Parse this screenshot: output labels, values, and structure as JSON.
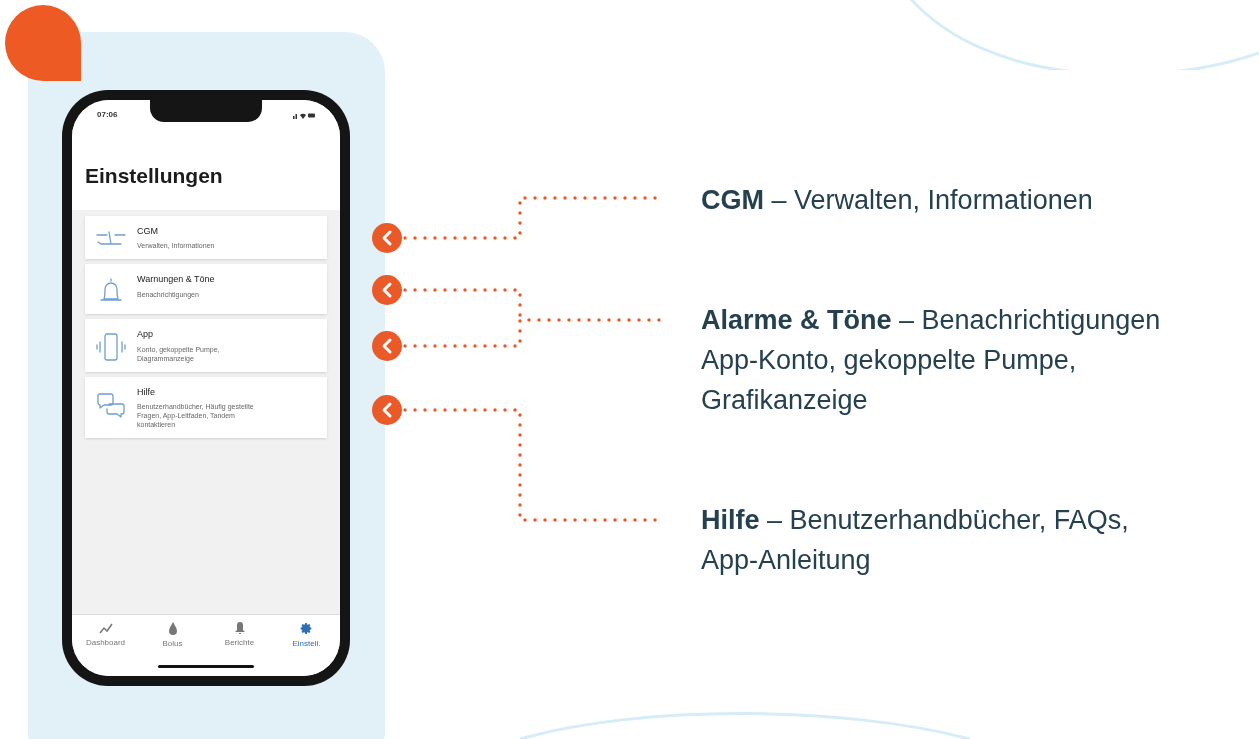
{
  "phone": {
    "status_time": "07:06",
    "title": "Einstellungen",
    "items": [
      {
        "kind": "cgm",
        "title": "CGM",
        "subtitle": "Verwalten, Informationen"
      },
      {
        "kind": "bell",
        "title": "Warnungen & Töne",
        "subtitle": "Benachrichtigungen"
      },
      {
        "kind": "phone",
        "title": "App",
        "subtitle": "Konto, gekoppelte Pumpe, Diagrammanzeige"
      },
      {
        "kind": "chat",
        "title": "Hilfe",
        "subtitle": "Benutzerhandbücher, Häufig gestellte Fragen, App-Leitfaden, Tandem kontaktieren"
      }
    ],
    "tabs": [
      {
        "kind": "chart",
        "label": "Dashboard",
        "selected": false
      },
      {
        "kind": "drop",
        "label": "Bolus",
        "selected": false
      },
      {
        "kind": "bell",
        "label": "Berichte",
        "selected": false
      },
      {
        "kind": "gear",
        "label": "Einstell.",
        "selected": true
      }
    ]
  },
  "callouts": [
    {
      "lines": [
        "**CGM** – Verwalten, Informationen"
      ]
    },
    {
      "lines": [
        "**Alarme & Töne** – Benachrichtigungen",
        "App-Konto, gekoppelte Pumpe,",
        "Grafikanzeige"
      ]
    },
    {
      "lines": [
        "**Hilfe** – Benutzerhandbücher, FAQs,",
        "App-Anleitung"
      ]
    }
  ]
}
